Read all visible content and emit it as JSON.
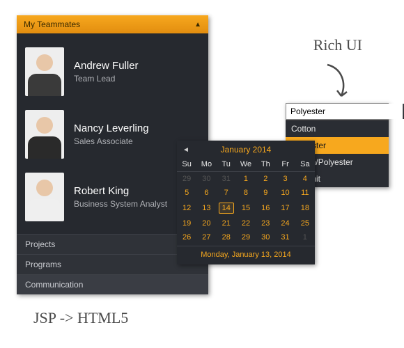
{
  "accordion": {
    "title": "My Teammates",
    "items": [
      {
        "label": "Projects"
      },
      {
        "label": "Programs"
      },
      {
        "label": "Communication"
      }
    ],
    "teammates": [
      {
        "name": "Andrew Fuller",
        "role": "Team Lead",
        "shirt": "#3a3a3a"
      },
      {
        "name": "Nancy Leverling",
        "role": "Sales Associate",
        "shirt": "#2a2a2a"
      },
      {
        "name": "Robert King",
        "role": "Business System Analyst",
        "shirt": "#efefef"
      }
    ]
  },
  "annotations": {
    "rich_ui": "Rich UI",
    "jsp": "JSP -> HTML5"
  },
  "combo": {
    "value": "Polyester",
    "options": [
      "Cotton",
      "Polyester",
      "Cotton/Polyester",
      "Rib Knit"
    ],
    "selected_index": 1
  },
  "calendar": {
    "title": "January 2014",
    "dow": [
      "Su",
      "Mo",
      "Tu",
      "We",
      "Th",
      "Fr",
      "Sa"
    ],
    "weeks": [
      [
        {
          "d": 29,
          "o": true
        },
        {
          "d": 30,
          "o": true
        },
        {
          "d": 31,
          "o": true
        },
        {
          "d": 1
        },
        {
          "d": 2
        },
        {
          "d": 3
        },
        {
          "d": 4
        }
      ],
      [
        {
          "d": 5
        },
        {
          "d": 6
        },
        {
          "d": 7
        },
        {
          "d": 8
        },
        {
          "d": 9
        },
        {
          "d": 10
        },
        {
          "d": 11
        }
      ],
      [
        {
          "d": 12
        },
        {
          "d": 13
        },
        {
          "d": 14,
          "sel": true
        },
        {
          "d": 15
        },
        {
          "d": 16
        },
        {
          "d": 17
        },
        {
          "d": 18
        }
      ],
      [
        {
          "d": 19
        },
        {
          "d": 20
        },
        {
          "d": 21
        },
        {
          "d": 22
        },
        {
          "d": 23
        },
        {
          "d": 24
        },
        {
          "d": 25
        }
      ],
      [
        {
          "d": 26
        },
        {
          "d": 27
        },
        {
          "d": 28
        },
        {
          "d": 29
        },
        {
          "d": 30
        },
        {
          "d": 31
        },
        {
          "d": 1,
          "o": true
        }
      ]
    ],
    "footer": "Monday, January 13, 2014"
  },
  "colors": {
    "accent": "#f7a81e",
    "panel": "#26292f"
  }
}
